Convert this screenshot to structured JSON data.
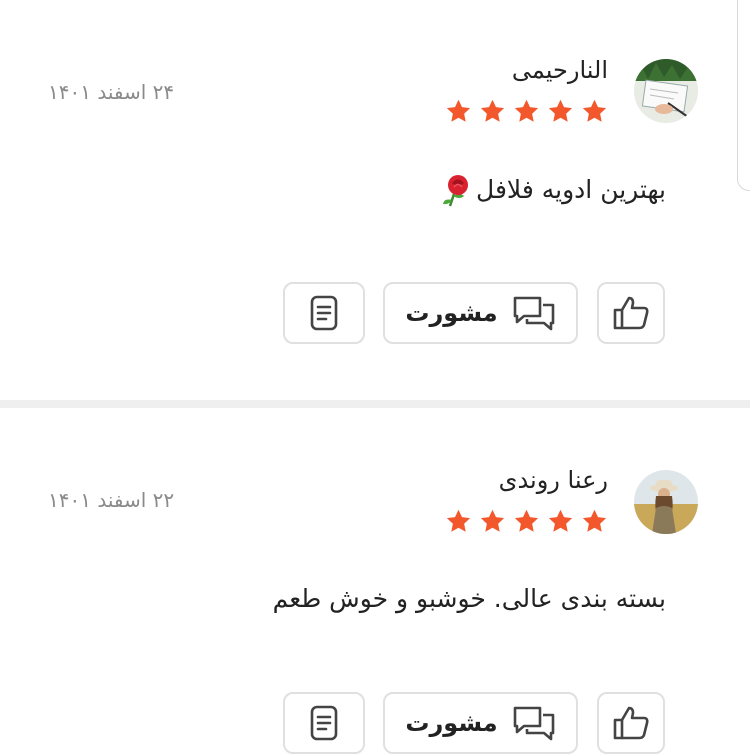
{
  "reviews": [
    {
      "author": "النارحیمی",
      "date": "۲۴ اسفند ۱۴۰۱",
      "rating": 5,
      "max_rating": 5,
      "comment": "بهترین ادویه فلافل",
      "comment_emoji": "rose-emoji",
      "actions": {
        "like_icon": "thumbs-up-icon",
        "consult_label": "مشورت",
        "consult_icon": "chat-bubbles-icon",
        "report_icon": "document-icon"
      }
    },
    {
      "author": "رعنا روندی",
      "date": "۲۲ اسفند ۱۴۰۱",
      "rating": 5,
      "max_rating": 5,
      "comment": "بسته بندی عالی. خوشبو و خوش طعم",
      "actions": {
        "like_icon": "thumbs-up-icon",
        "consult_label": "مشورت",
        "consult_icon": "chat-bubbles-icon",
        "report_icon": "document-icon"
      }
    }
  ],
  "colors": {
    "star": "#f2582b",
    "date": "#8a8a8a",
    "border": "#e0e0e0",
    "divider": "#efefef"
  }
}
